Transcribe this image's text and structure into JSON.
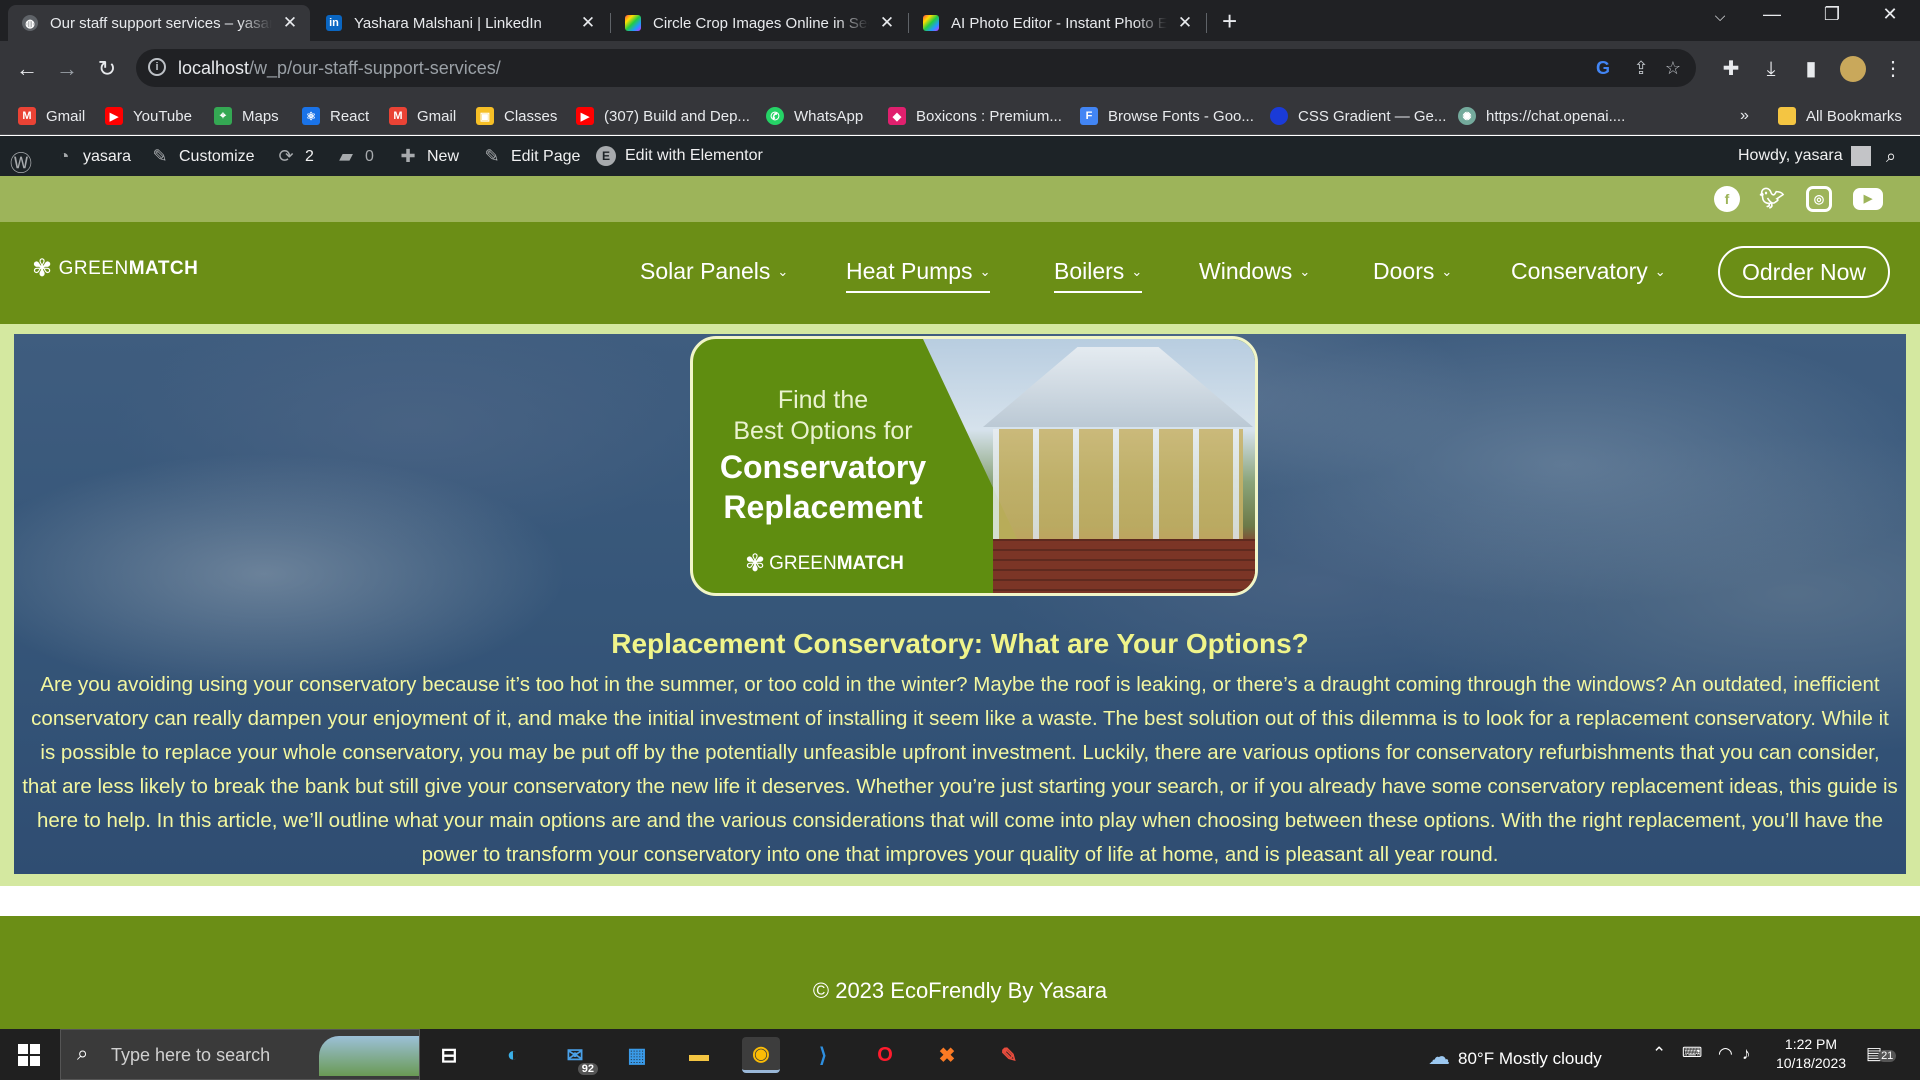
{
  "browser": {
    "tabs": [
      {
        "title": "Our staff support services – yasara",
        "icon": "globe-icon",
        "active": true
      },
      {
        "title": "Yashara Malshani | LinkedIn",
        "icon": "linkedin-icon"
      },
      {
        "title": "Circle Crop Images Online in Seconds",
        "icon": "rainbow-square-icon"
      },
      {
        "title": "AI Photo Editor - Instant Photo Editing",
        "icon": "rainbow-square-icon"
      }
    ],
    "url_host": "localhost",
    "url_path": "/w_p/our-staff-support-services/",
    "bookmarks": [
      {
        "label": "Gmail",
        "icon": "gmail-icon",
        "color": "#ea4335"
      },
      {
        "label": "YouTube",
        "icon": "youtube-icon",
        "color": "#ff0000"
      },
      {
        "label": "Maps",
        "icon": "maps-icon",
        "color": "#34a853"
      },
      {
        "label": "React",
        "icon": "react-icon",
        "color": "#1a73e8"
      },
      {
        "label": "Gmail",
        "icon": "gmail-icon",
        "color": "#ea4335"
      },
      {
        "label": "Classes",
        "icon": "classroom-icon",
        "color": "#f6bf26"
      },
      {
        "label": "(307) Build and Dep...",
        "icon": "youtube-icon",
        "color": "#ff0000"
      },
      {
        "label": "WhatsApp",
        "icon": "whatsapp-icon",
        "color": "#25d366"
      },
      {
        "label": "Boxicons : Premium...",
        "icon": "boxicons-icon",
        "color": "#e0206e"
      },
      {
        "label": "Browse Fonts - Goo...",
        "icon": "google-fonts-icon",
        "color": "#4285f4"
      },
      {
        "label": "CSS Gradient — Ge...",
        "icon": "css-gradient-icon",
        "color": "#1a3bd8"
      },
      {
        "label": "https://chat.openai....",
        "icon": "openai-icon",
        "color": "#74aa9c"
      }
    ],
    "all_bookmarks": "All Bookmarks"
  },
  "adminbar": {
    "site": "yasara",
    "customize": "Customize",
    "updates_count": "2",
    "comments_count": "0",
    "new": "New",
    "edit_page": "Edit Page",
    "edit_elementor": "Edit with Elementor",
    "howdy": "Howdy, yasara"
  },
  "site": {
    "logo_thin": "GREEN",
    "logo_bold": "MATCH",
    "menu": [
      "Solar Panels",
      "Heat Pumps",
      "Boilers",
      "Windows",
      "Doors",
      "Conservatory"
    ],
    "order_button": "Odrder Now",
    "banner": {
      "line1": "Find the",
      "line2": "Best Options for",
      "line3": "Conservatory",
      "line4": "Replacement",
      "logo_thin": "GREEN",
      "logo_bold": "MATCH"
    },
    "hero_title": "Replacement Conservatory: What are Your Options?",
    "hero_text": "Are you avoiding using your conservatory because it’s too hot in the summer, or too cold in the winter? Maybe the roof is leaking, or there’s a draught coming through the windows? An outdated, inefficient conservatory can really dampen your enjoyment of it, and make the initial investment of installing it seem like a waste. The best solution out of this dilemma is to look for a replacement conservatory. While it is possible to replace your whole conservatory, you may be put off by the potentially unfeasible upfront investment. Luckily, there are various options for conservatory refurbishments that you can consider, that are less likely to break the bank but still give your conservatory the new life it deserves. Whether you’re just starting your search, or if you already have some conservatory replacement ideas, this guide is here to help. In this article, we’ll outline what your main options are and the various considerations that will come into play when choosing between these options. With the right replacement, you’ll have the power to transform your conservatory into one that improves your quality of life at home, and is pleasant all year round.",
    "footer": "© 2023 EcoFrendly By Yasara",
    "colors": {
      "brand_green": "#6b8e16",
      "top_strip": "#9db45a",
      "hero_text": "#f3f7a0"
    }
  },
  "taskbar": {
    "search_placeholder": "Type here to search",
    "mail_badge": "92",
    "weather": "80°F  Mostly cloudy",
    "time": "1:22 PM",
    "date": "10/18/2023",
    "notif_count": "21"
  }
}
